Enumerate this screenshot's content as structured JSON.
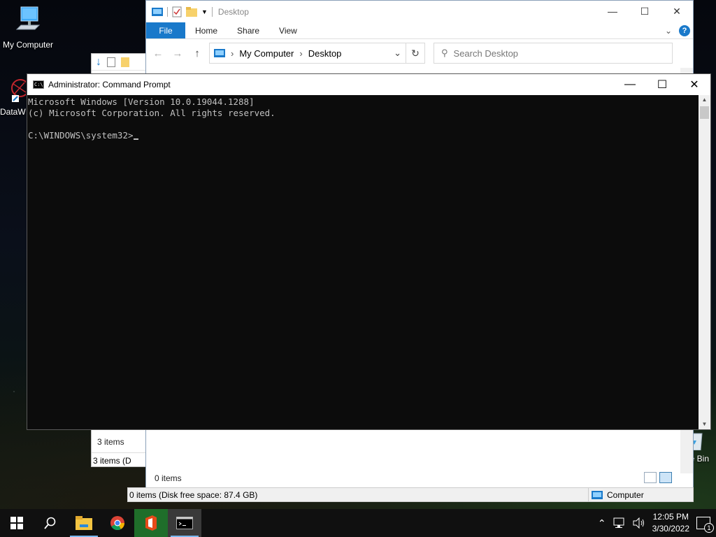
{
  "desktop": {
    "icons": [
      {
        "label": "My Computer",
        "icon": "computer-icon"
      },
      {
        "label": "DataW",
        "icon": "datawrapper-icon"
      },
      {
        "label": "ycle Bin",
        "icon": "recycle-bin-icon"
      }
    ]
  },
  "background_explorer": {
    "status_items": "3 items",
    "status_items_bar": "3 items (D"
  },
  "explorer": {
    "title": "Desktop",
    "ribbon_tabs": {
      "file": "File",
      "home": "Home",
      "share": "Share",
      "view": "View"
    },
    "breadcrumb": [
      "My Computer",
      "Desktop"
    ],
    "search_placeholder": "Search Desktop",
    "items_count": "0 items",
    "status_text": "0 items (Disk free space: 87.4 GB)",
    "status_location": "Computer",
    "accent": "#1979ca"
  },
  "cmd": {
    "title": "Administrator: Command Prompt",
    "lines": [
      "Microsoft Windows [Version 10.0.19044.1288]",
      "(c) Microsoft Corporation. All rights reserved.",
      "",
      "C:\\WINDOWS\\system32>"
    ]
  },
  "taskbar": {
    "apps": [
      "windows-start-icon",
      "search-icon",
      "file-explorer-icon",
      "chrome-icon",
      "office-icon",
      "command-prompt-icon"
    ],
    "time": "12:05 PM",
    "date": "3/30/2022",
    "notification_count": "1"
  }
}
